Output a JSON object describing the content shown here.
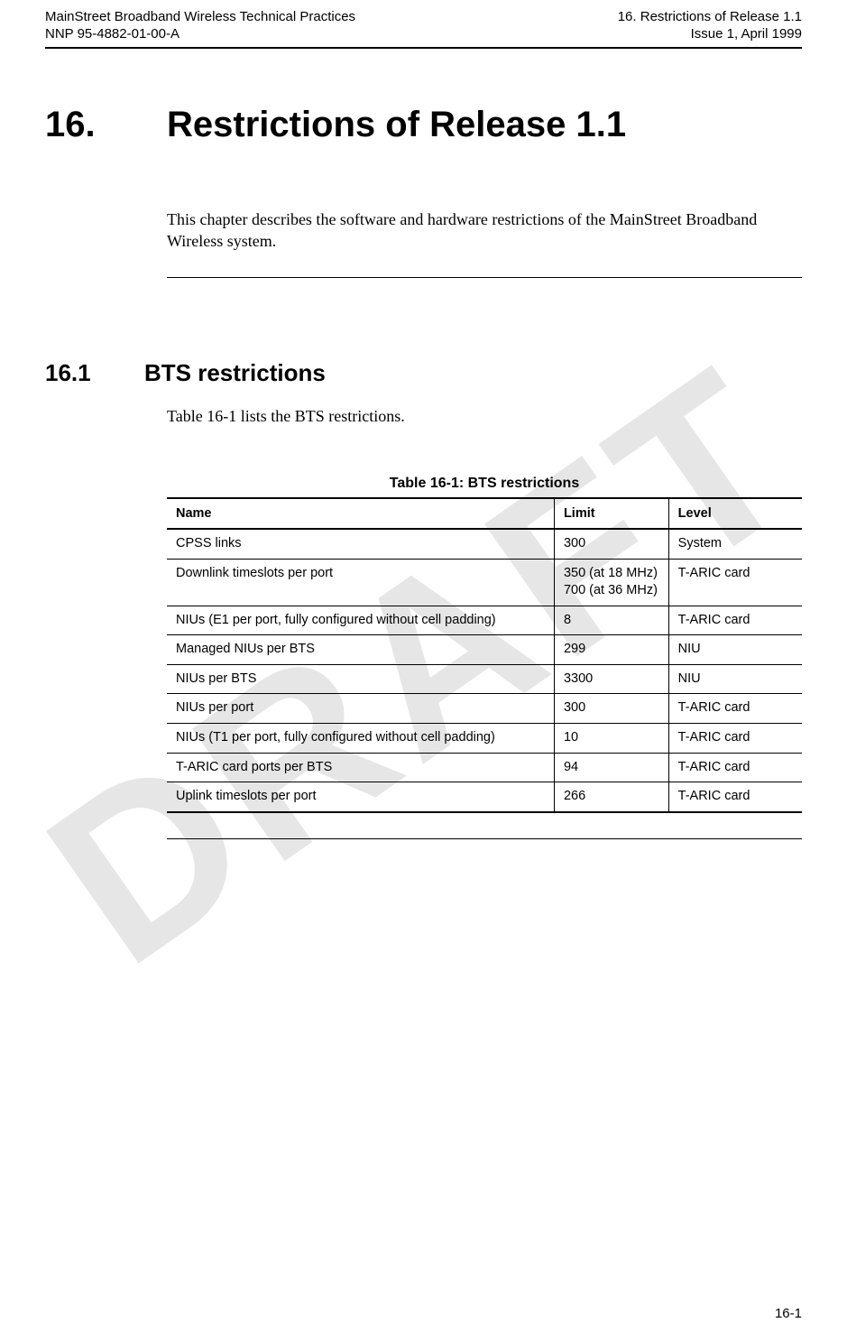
{
  "header": {
    "left_line1": "MainStreet Broadband Wireless Technical Practices",
    "left_line2": "NNP 95-4882-01-00-A",
    "right_line1": "16. Restrictions of Release 1.1",
    "right_line2": "Issue 1, April 1999"
  },
  "watermark": "DRAFT",
  "chapter": {
    "number": "16.",
    "title": "Restrictions of Release 1.1",
    "intro": "This chapter describes the software and hardware restrictions of the MainStreet Broadband Wireless system."
  },
  "section": {
    "number": "16.1",
    "title": "BTS restrictions",
    "body": "Table 16-1 lists the BTS restrictions."
  },
  "table": {
    "caption": "Table 16-1:  BTS restrictions",
    "headers": {
      "c0": "Name",
      "c1": "Limit",
      "c2": "Level"
    },
    "rows": [
      {
        "name": "CPSS links",
        "limit": "300",
        "level": "System"
      },
      {
        "name": "Downlink timeslots per port",
        "limit": "350 (at 18 MHz)\n700 (at 36 MHz)",
        "level": "T-ARIC card"
      },
      {
        "name": "NIUs (E1 per port, fully configured without cell padding)",
        "limit": "8",
        "level": "T-ARIC card"
      },
      {
        "name": "Managed NIUs per BTS",
        "limit": "299",
        "level": "NIU"
      },
      {
        "name": "NIUs per BTS",
        "limit": "3300",
        "level": "NIU"
      },
      {
        "name": "NIUs per port",
        "limit": "300",
        "level": "T-ARIC card"
      },
      {
        "name": "NIUs (T1 per port, fully configured without cell padding)",
        "limit": "10",
        "level": "T-ARIC card"
      },
      {
        "name": "T-ARIC card ports per BTS",
        "limit": "94",
        "level": "T-ARIC card"
      },
      {
        "name": "Uplink timeslots per port",
        "limit": "266",
        "level": "T-ARIC card"
      }
    ]
  },
  "footer": {
    "page": "16-1"
  }
}
